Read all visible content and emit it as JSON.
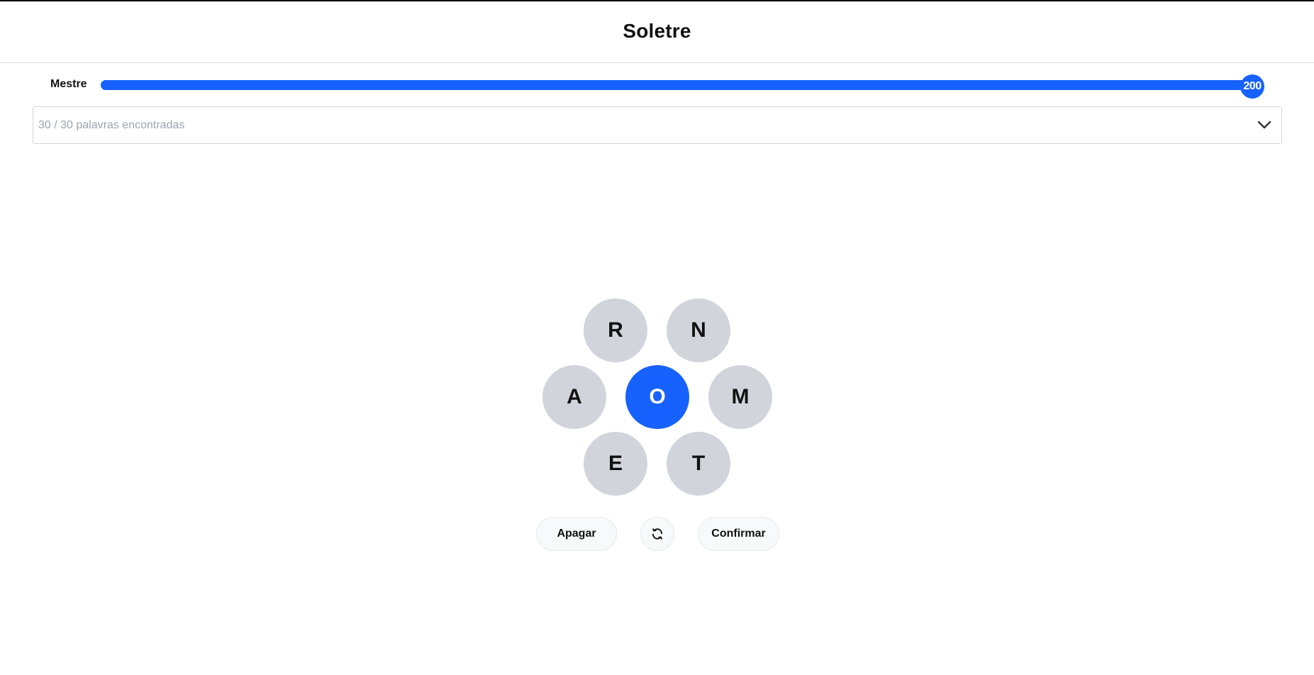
{
  "app": {
    "title": "Soletre"
  },
  "progress": {
    "rank_label": "Mestre",
    "score": "200",
    "fill_fraction": 1.0,
    "accent_color": "#1761ff"
  },
  "found_words": {
    "summary": "30 / 30 palavras encontradas",
    "toggle_icon": "chevron-down-icon"
  },
  "hive": {
    "center_letter": "O",
    "outer_letters": {
      "top_left": "R",
      "top_right": "N",
      "left": "A",
      "right": "M",
      "bottom_left": "E",
      "bottom_right": "T"
    }
  },
  "actions": {
    "delete_label": "Apagar",
    "shuffle_icon": "shuffle-icon",
    "confirm_label": "Confirmar"
  }
}
